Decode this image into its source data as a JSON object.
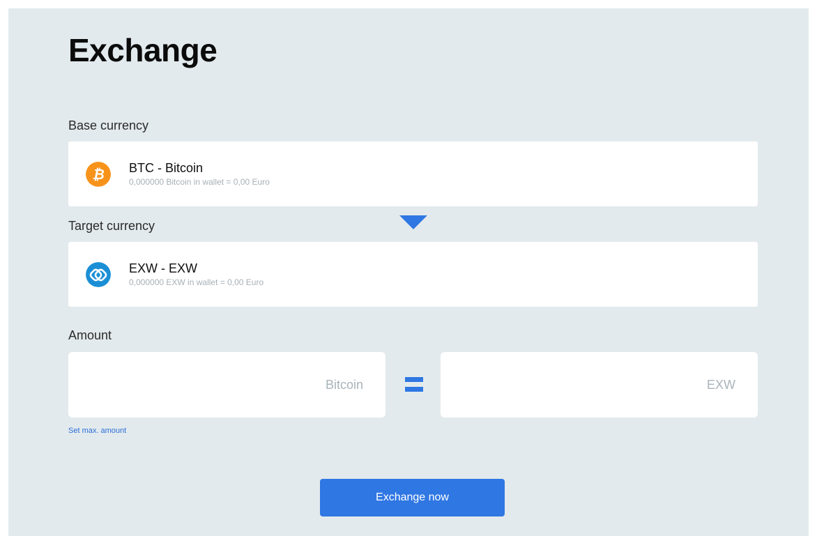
{
  "page": {
    "title": "Exchange"
  },
  "base": {
    "label": "Base currency",
    "name": "BTC - Bitcoin",
    "wallet_info": "0,000000 Bitcoin in wallet = 0,00 Euro",
    "icon": "bitcoin-icon",
    "icon_color": "#f7931a"
  },
  "target": {
    "label": "Target currency",
    "name": "EXW - EXW",
    "wallet_info": "0,000000 EXW in wallet = 0,00 Euro",
    "icon": "exw-icon",
    "icon_color": "#1b8fd6"
  },
  "amount": {
    "label": "Amount",
    "base_unit": "Bitcoin",
    "target_unit": "EXW",
    "base_value": "",
    "target_value": "",
    "set_max_label": "Set max. amount"
  },
  "actions": {
    "exchange_label": "Exchange now"
  },
  "colors": {
    "accent": "#2f77e3",
    "background": "#e3eaed"
  }
}
